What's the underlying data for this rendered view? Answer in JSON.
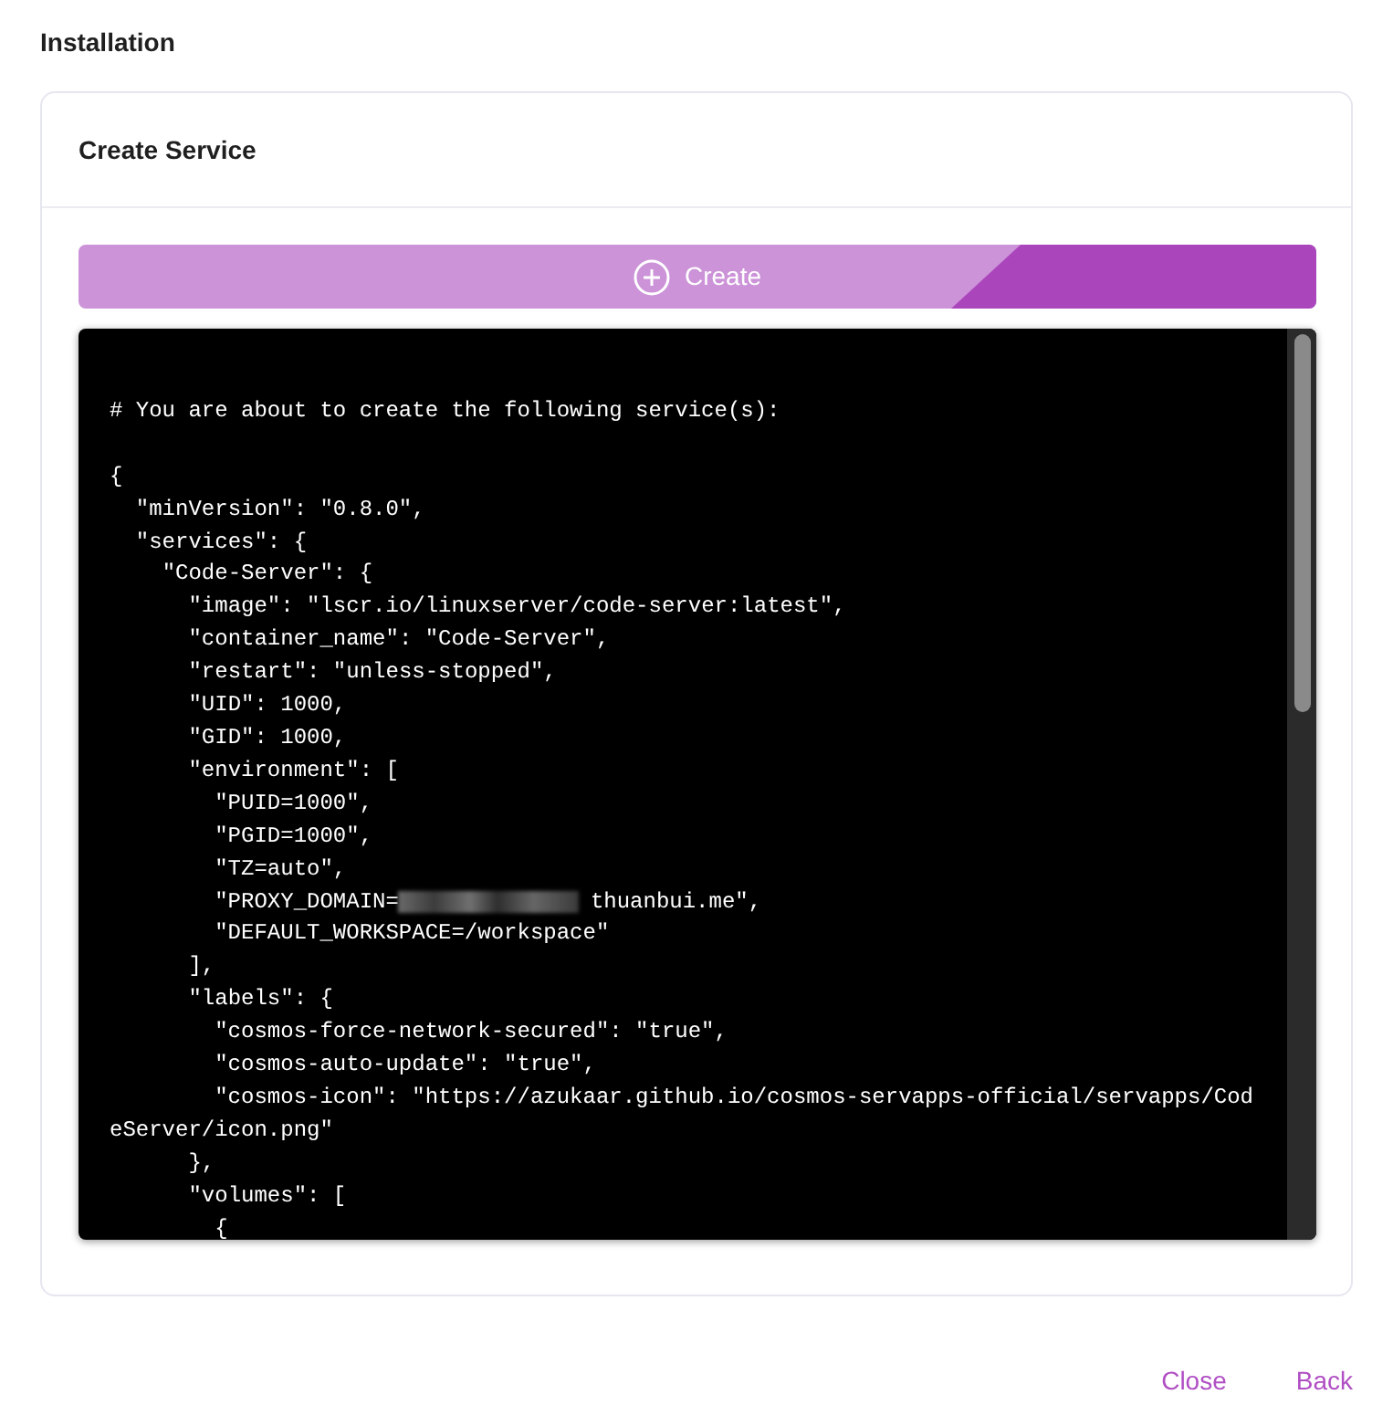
{
  "page_title": "Installation",
  "card": {
    "title": "Create Service",
    "create_button": {
      "label": "Create"
    },
    "code": {
      "before": "\n# You are about to create the following service(s):\n\n{\n  \"minVersion\": \"0.8.0\",\n  \"services\": {\n    \"Code-Server\": {\n      \"image\": \"lscr.io/linuxserver/code-server:latest\",\n      \"container_name\": \"Code-Server\",\n      \"restart\": \"unless-stopped\",\n      \"UID\": 1000,\n      \"GID\": 1000,\n      \"environment\": [\n        \"PUID=1000\",\n        \"PGID=1000\",\n        \"TZ=auto\",",
      "redacted_line": {
        "prefix": "        \"PROXY_DOMAIN=",
        "redacted": true,
        "suffix": "thuanbui.me\","
      },
      "after": "        \"DEFAULT_WORKSPACE=/workspace\"\n      ],\n      \"labels\": {\n        \"cosmos-force-network-secured\": \"true\",\n        \"cosmos-auto-update\": \"true\",\n        \"cosmos-icon\": \"https://azukaar.github.io/cosmos-servapps-official/servapps/CodeServer/icon.png\"\n      },\n      \"volumes\": [\n        {"
    }
  },
  "footer": {
    "buttons": [
      "Close",
      "Back"
    ]
  }
}
